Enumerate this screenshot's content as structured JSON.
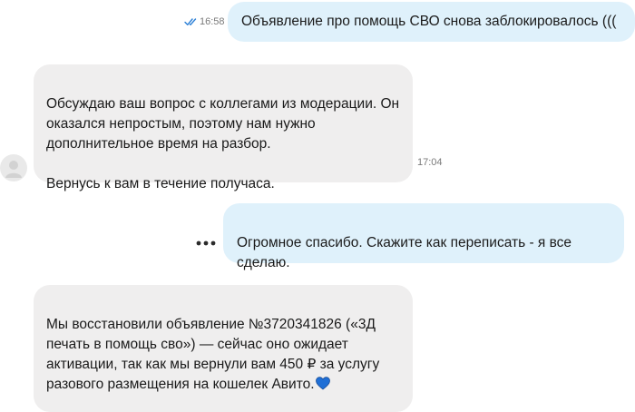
{
  "messages": [
    {
      "direction": "outgoing",
      "text": "Объявление про помощь СВО снова заблокировалось (((",
      "time": "16:58",
      "status": "read"
    },
    {
      "direction": "incoming",
      "text": "Обсуждаю ваш вопрос с коллегами из модерации. Он\nоказался непростым, поэтому нам нужно\nдополнительное время на разбор.\n\nВернусь к вам в течение получаса.",
      "time": "17:04"
    },
    {
      "direction": "outgoing",
      "text": "Огромное спасибо. Скажите как переписать - я все\nсделаю."
    },
    {
      "direction": "incoming",
      "text": "Мы восстановили объявление №3720341826 («3Д\nпечать в помощь сво») — сейчас оно ожидает\nактивации, так как мы вернули вам 450 ₽ за услугу\nразового размещения на кошелек Авито.",
      "emoji": "blue-heart"
    }
  ],
  "colors": {
    "outgoing_bubble": "#dff1fb",
    "incoming_bubble": "#efeeee",
    "read_checks": "#2b7fd6",
    "heart": "#1f6fd6"
  },
  "icons": [
    "double-check-icon",
    "avatar-icon",
    "more-dots-icon",
    "blue-heart-icon"
  ]
}
